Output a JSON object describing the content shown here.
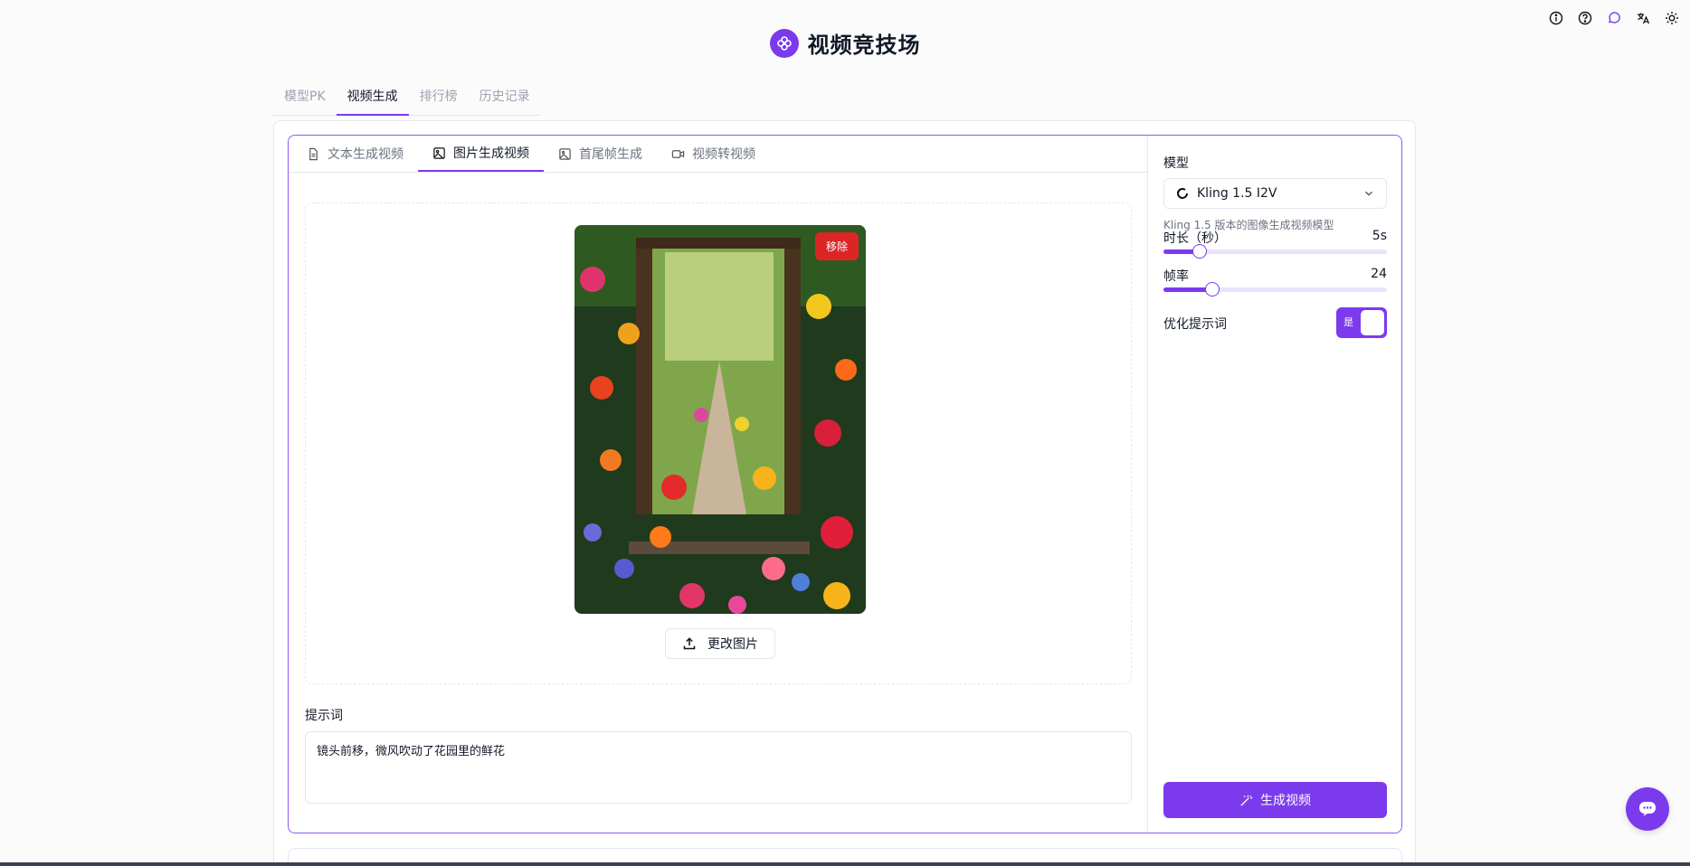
{
  "app": {
    "title": "视频竞技场"
  },
  "top_icons": [
    "info-icon",
    "help-icon",
    "chat-icon",
    "translate-icon",
    "theme-sun-icon"
  ],
  "main_tabs": [
    {
      "label": "模型PK",
      "active": false
    },
    {
      "label": "视频生成",
      "active": true
    },
    {
      "label": "排行榜",
      "active": false
    },
    {
      "label": "历史记录",
      "active": false
    }
  ],
  "sub_tabs": [
    {
      "label": "文本生成视频",
      "icon": "document-icon",
      "active": false
    },
    {
      "label": "图片生成视频",
      "icon": "image-icon",
      "active": true
    },
    {
      "label": "首尾帧生成",
      "icon": "image-icon",
      "active": false
    },
    {
      "label": "视频转视频",
      "icon": "video-camera-icon",
      "active": false
    }
  ],
  "upload": {
    "remove_label": "移除",
    "change_label": "更改图片"
  },
  "prompt": {
    "label": "提示词",
    "value": "镜头前移，微风吹动了花园里的鲜花"
  },
  "settings": {
    "model_label": "模型",
    "model_value": "Kling 1.5 I2V",
    "model_desc": "Kling 1.5 版本的图像生成视频模型",
    "duration_label": "时长（秒）",
    "duration_value": "5s",
    "duration_fraction": 0.16,
    "fps_label": "帧率",
    "fps_value": "24",
    "fps_fraction": 0.22,
    "optimize_label": "优化提示词",
    "optimize_toggle_text": "是",
    "optimize_on": true
  },
  "generate_label": "生成视频",
  "colors": {
    "accent": "#7c3aed",
    "danger": "#dc2626"
  }
}
